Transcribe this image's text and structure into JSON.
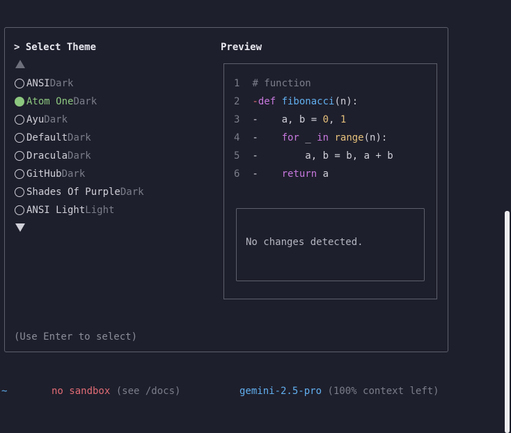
{
  "dialog": {
    "title": "> Select Theme",
    "preview_title": "Preview",
    "scroll_up_symbol": "▲",
    "scroll_down_symbol": "▼",
    "hint": "(Use Enter to select)",
    "themes": [
      {
        "name": "ANSI",
        "variant": "Dark",
        "selected": false
      },
      {
        "name": "Atom One",
        "variant": "Dark",
        "selected": true
      },
      {
        "name": "Ayu",
        "variant": "Dark",
        "selected": false
      },
      {
        "name": "Default",
        "variant": "Dark",
        "selected": false
      },
      {
        "name": "Dracula",
        "variant": "Dark",
        "selected": false
      },
      {
        "name": "GitHub",
        "variant": "Dark",
        "selected": false
      },
      {
        "name": "Shades Of Purple",
        "variant": "Dark",
        "selected": false
      },
      {
        "name": "ANSI Light",
        "variant": "Light",
        "selected": false
      }
    ]
  },
  "preview": {
    "code_lines": [
      {
        "num": "1",
        "tokens": [
          {
            "t": " ",
            "c": "plain"
          },
          {
            "t": "# function",
            "c": "comment"
          }
        ]
      },
      {
        "num": "2",
        "tokens": [
          {
            "t": " -",
            "c": "dash"
          },
          {
            "t": "def ",
            "c": "kw"
          },
          {
            "t": "fibonacci",
            "c": "fn"
          },
          {
            "t": "(n):",
            "c": "plain"
          }
        ]
      },
      {
        "num": "3",
        "tokens": [
          {
            "t": " -",
            "c": "plain"
          },
          {
            "t": "    a, b = ",
            "c": "plain"
          },
          {
            "t": "0",
            "c": "num"
          },
          {
            "t": ", ",
            "c": "plain"
          },
          {
            "t": "1",
            "c": "num"
          }
        ]
      },
      {
        "num": "4",
        "tokens": [
          {
            "t": " -",
            "c": "plain"
          },
          {
            "t": "    ",
            "c": "plain"
          },
          {
            "t": "for",
            "c": "kw"
          },
          {
            "t": " _ ",
            "c": "plain"
          },
          {
            "t": "in",
            "c": "kw"
          },
          {
            "t": " ",
            "c": "plain"
          },
          {
            "t": "range",
            "c": "bi"
          },
          {
            "t": "(n):",
            "c": "plain"
          }
        ]
      },
      {
        "num": "5",
        "tokens": [
          {
            "t": " -",
            "c": "plain"
          },
          {
            "t": "        a, b = b, a + b",
            "c": "plain"
          }
        ]
      },
      {
        "num": "6",
        "tokens": [
          {
            "t": " -",
            "c": "plain"
          },
          {
            "t": "    ",
            "c": "plain"
          },
          {
            "t": "return",
            "c": "kw"
          },
          {
            "t": " a",
            "c": "plain"
          }
        ]
      }
    ],
    "diff_message": "No changes detected."
  },
  "footer": {
    "tilde": "~",
    "sandbox": "no sandbox",
    "sandbox_hint": "(see /docs)",
    "model": "gemini-2.5-pro",
    "context": "(100% context left)"
  },
  "colors": {
    "background": "#1e1f2c",
    "selected": "#8cc77f",
    "accent_blue": "#61afef",
    "accent_red": "#e06c75"
  }
}
